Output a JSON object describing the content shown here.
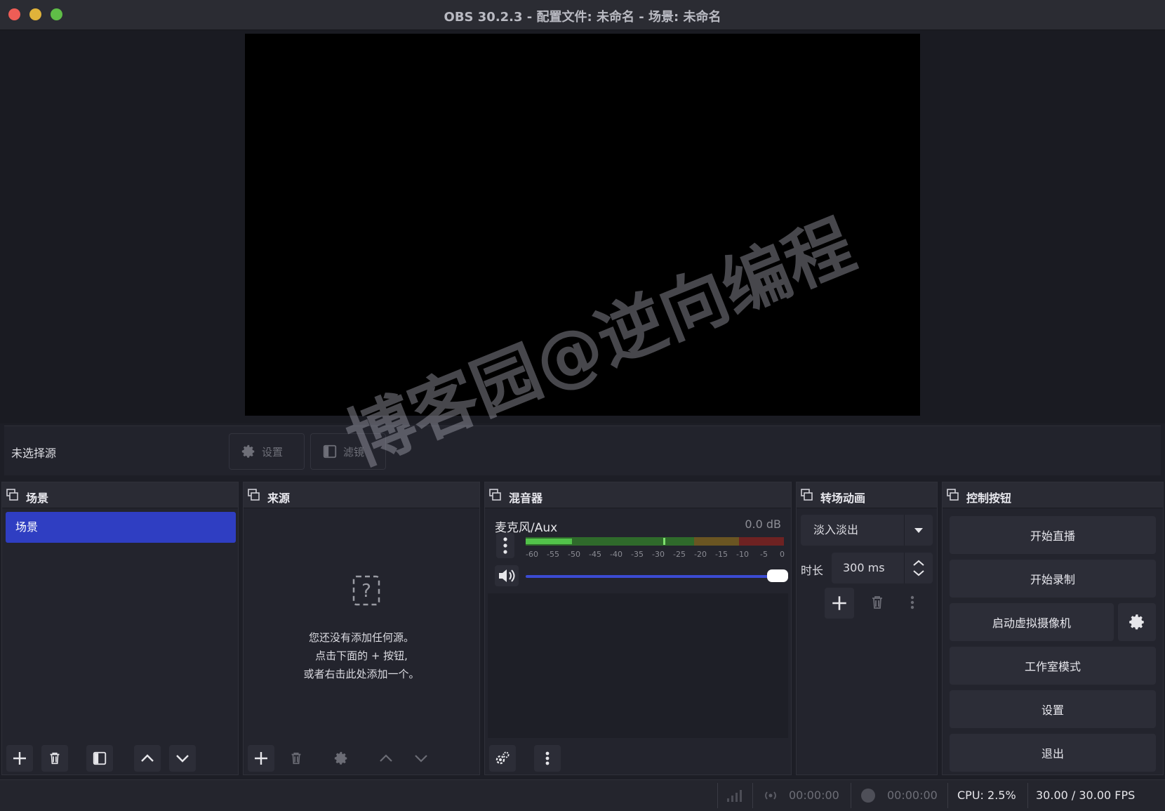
{
  "window": {
    "title": "OBS 30.2.3 - 配置文件: 未命名 - 场景: 未命名"
  },
  "context_bar": {
    "no_source_label": "未选择源",
    "settings_label": "设置",
    "filters_label": "滤镜"
  },
  "scenes": {
    "title": "场景",
    "items": [
      "场景"
    ]
  },
  "sources": {
    "title": "来源",
    "empty_line1": "您还没有添加任何源。",
    "empty_line2": "点击下面的 + 按钮,",
    "empty_line3": "或者右击此处添加一个。"
  },
  "mixer": {
    "title": "混音器",
    "channel_name": "麦克风/Aux",
    "channel_db": "0.0 dB",
    "ticks": [
      "-60",
      "-55",
      "-50",
      "-45",
      "-40",
      "-35",
      "-30",
      "-25",
      "-20",
      "-15",
      "-10",
      "-5",
      "0"
    ],
    "volume_level": 1.0
  },
  "transitions": {
    "title": "转场动画",
    "selected": "淡入淡出",
    "duration_label": "时长",
    "duration_value": "300 ms"
  },
  "controls": {
    "title": "控制按钮",
    "start_stream": "开始直播",
    "start_record": "开始录制",
    "start_virtualcam": "启动虚拟摄像机",
    "studio_mode": "工作室模式",
    "settings": "设置",
    "exit": "退出"
  },
  "status": {
    "stream_time": "00:00:00",
    "record_time": "00:00:00",
    "cpu": "CPU: 2.5%",
    "fps": "30.00 / 30.00 FPS"
  },
  "watermark": "博客园@逆向编程",
  "colors": {
    "accent": "#2f3ec2",
    "meter_green": "#3fae3b",
    "meter_yellow": "#b58a2a",
    "meter_red": "#b02a2a"
  }
}
